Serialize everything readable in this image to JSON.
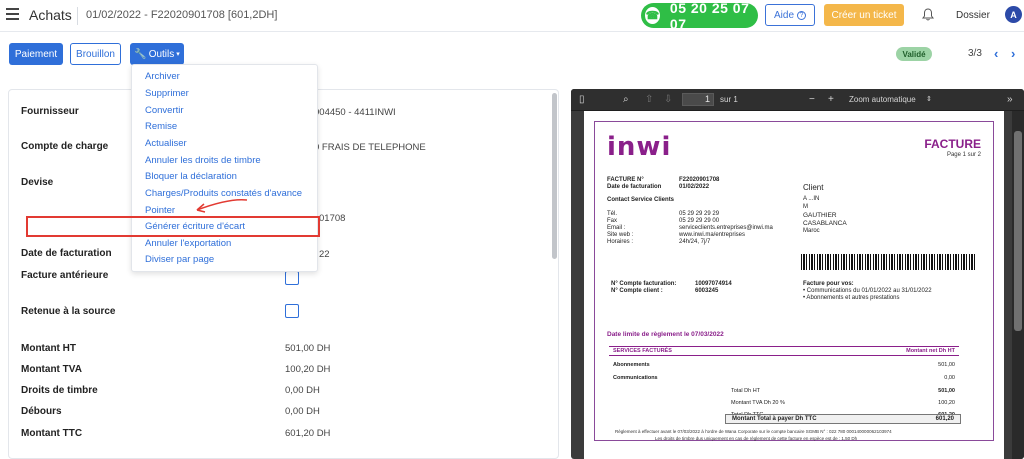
{
  "header": {
    "app_title": "Achats",
    "doc_ref": "01/02/2022 - F22020901708 [601,2DH]",
    "phone": "05 20 25 07 07",
    "help": "Aide",
    "ticket": "Créer un ticket",
    "dossier": "Dossier",
    "avatar": "A"
  },
  "toolbar": {
    "paiement": "Paiement",
    "brouillon": "Brouillon",
    "outils": "Outils",
    "status": "Validé",
    "pager": "3/3"
  },
  "dropdown": {
    "items": [
      "Archiver",
      "Supprimer",
      "Convertir",
      "Remise",
      "Actualiser",
      "Annuler les droits de timbre",
      "Bloquer la déclaration",
      "Charges/Produits constatés d'avance",
      "Pointer",
      "Générer écriture d'écart",
      "Annuler l'exportation",
      "Diviser par page"
    ]
  },
  "form": {
    "fournisseur_label": "Fournisseur",
    "fournisseur_value": "004450 - 4411INWI",
    "compte_label": "Compte de charge",
    "compte_value": "0 FRAIS DE TELEPHONE",
    "devise_label": "Devise",
    "ref_value": "01708",
    "date_label": "Date de facturation",
    "date_value": "22",
    "anterieure_label": "Facture antérieure",
    "retenue_label": "Retenue à la source",
    "ht_label": "Montant HT",
    "ht_value": "501,00 DH",
    "tva_label": "Montant TVA",
    "tva_value": "100,20 DH",
    "timbre_label": "Droits de timbre",
    "timbre_value": "0,00 DH",
    "debours_label": "Débours",
    "debours_value": "0,00 DH",
    "ttc_label": "Montant TTC",
    "ttc_value": "601,20 DH"
  },
  "pdf_toolbar": {
    "page_num": "1",
    "page_of": "sur 1",
    "zoom": "Zoom automatique"
  },
  "invoice": {
    "logo": "inwi",
    "title": "FACTURE",
    "page": "Page 1 sur 2",
    "facture_no_label": "FACTURE N°",
    "facture_no": "F22020901708",
    "date_fact_label": "Date de facturation",
    "date_fact": "01/02/2022",
    "contact": "Contact Service Clients",
    "tel_label": "Tél.",
    "tel": "05 29 29 29 29",
    "fax_label": "Fax",
    "fax": "05 29 29 29 00",
    "email_label": "Email :",
    "email": "serviceclients.entreprises@inwi.ma",
    "web_label": "Site web :",
    "web": "www.inwi.ma/entreprises",
    "hours_label": "Horaires :",
    "hours": "24h/24, 7j/7",
    "client_label": "Client",
    "client_lines": [
      "A                                 ...IN",
      "M",
      "GAUTHIER",
      "CASABLANCA",
      "Maroc"
    ],
    "compte_fact_label": "N° Compte facturation:",
    "compte_fact": "10097074914",
    "compte_client_label": "N° Compte client :",
    "compte_client": "6003245",
    "facture_pour": "Facture pour vos:",
    "pour_1": "• Communications du 01/01/2022 au 31/01/2022",
    "pour_2": "• Abonnements et autres prestations",
    "deadline": "Date limite de règlement le 07/03/2022",
    "svc_head_left": "SERVICES FACTURÉS",
    "svc_head_right": "Montant net Dh HT",
    "abonnements": "Abonnements",
    "abonnements_val": "501,00",
    "communications": "Communications",
    "communications_val": "0,00",
    "total_ht": "Total Dh HT",
    "total_ht_val": "501,00",
    "tva_line": "Montant TVA Dh 20 %",
    "tva_line_val": "100,20",
    "total_ttc": "Total Dh TTC",
    "total_ttc_val": "601,20",
    "total_payer": "Montant Total à payer Dh TTC",
    "total_payer_val": "601,20",
    "footer_1": "Règlement à effectuer avant le 07/03/2022 à l'ordre de Wana Corporate sur le compte bancaire SGMB N° : 022 780 000140000062103974",
    "footer_2": "Les droits de timbre dus uniquement en cas de règlement de cette facture en espèce est de : 1,50 Dh"
  },
  "colors": {
    "primary": "#2f6fd9",
    "phone": "#2fbe46",
    "ticket": "#f4b74a",
    "badge": "#9cd3a5",
    "highlight": "#e23a32",
    "inwi": "#8a1f8a"
  }
}
